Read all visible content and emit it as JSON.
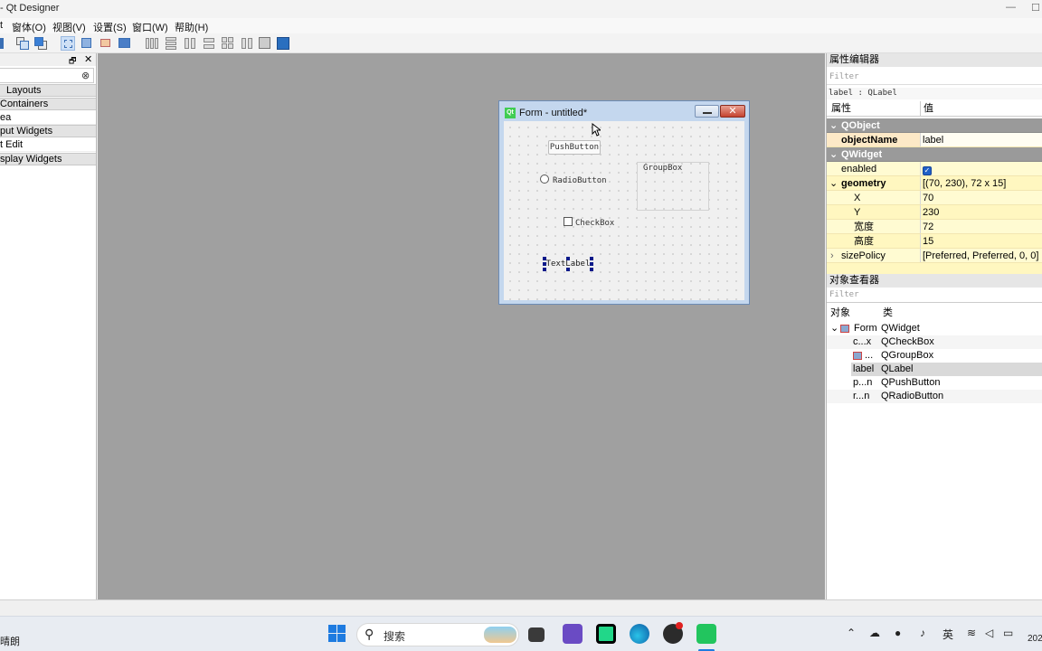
{
  "window": {
    "title": "- Qt Designer",
    "minimize_glyph": "—",
    "maximize_glyph": "☐"
  },
  "menu": {
    "items": [
      "t",
      "窗体(O)",
      "视图(V)",
      "设置(S)",
      "窗口(W)",
      "帮助(H)"
    ]
  },
  "toolbar": {
    "icons": [
      "new-form-icon",
      "send-to-back-icon",
      "bring-to-front-icon",
      "edit-widgets-icon",
      "edit-signals-icon",
      "edit-buddies-icon",
      "edit-tab-order-icon",
      "layout-horizontal-icon",
      "layout-vertical-icon",
      "layout-splitter-h-icon",
      "layout-splitter-v-icon",
      "layout-grid-icon",
      "layout-form-icon",
      "break-layout-icon",
      "adjust-size-icon"
    ]
  },
  "widget_box": {
    "categories": [
      "Layouts",
      "Containers",
      "ea",
      "put Widgets",
      "t Edit",
      "splay Widgets"
    ],
    "float_glyph": "🗗",
    "close_glyph": "✕",
    "clear_glyph": "⊗"
  },
  "form": {
    "title": "Form - untitled*",
    "icon_text": "Qt",
    "close_glyph": "✕",
    "push_button": "PushButton",
    "radio_button": "RadioButton",
    "group_box": "GroupBox",
    "check_box": "CheckBox",
    "text_label": "TextLabel"
  },
  "property_editor": {
    "title": "属性编辑器",
    "filter_placeholder": "Filter",
    "object_line": "label : QLabel",
    "col_property": "属性",
    "col_value": "值",
    "rows": [
      {
        "key": "QObject",
        "value": ""
      },
      {
        "key": "objectName",
        "value": "label"
      },
      {
        "key": "QWidget",
        "value": ""
      },
      {
        "key": "enabled",
        "value": ""
      },
      {
        "key": "geometry",
        "value": "[(70, 230), 72 x 15]"
      },
      {
        "key": "X",
        "value": "70"
      },
      {
        "key": "Y",
        "value": "230"
      },
      {
        "key": "宽度",
        "value": "72"
      },
      {
        "key": "高度",
        "value": "15"
      },
      {
        "key": "sizePolicy",
        "value": "[Preferred, Preferred, 0, 0]"
      }
    ]
  },
  "object_inspector": {
    "title": "对象查看器",
    "filter_placeholder": "Filter",
    "col_object": "对象",
    "col_class": "类",
    "rows": [
      {
        "object": "Form",
        "class": "QWidget"
      },
      {
        "object": "c...x",
        "class": "QCheckBox"
      },
      {
        "object": "...",
        "class": "QGroupBox"
      },
      {
        "object": "label",
        "class": "QLabel"
      },
      {
        "object": "p...n",
        "class": "QPushButton"
      },
      {
        "object": "r...n",
        "class": "QRadioButton"
      }
    ]
  },
  "taskbar": {
    "weather": "晴朗",
    "search_label": "搜索",
    "ime": "英",
    "clock": "202"
  },
  "colors": {
    "accent": "#1f5fc7",
    "group_header": "#9a9a9a",
    "mdi_bg": "#a0a0a0",
    "property_highlight": "#fde9c7"
  }
}
